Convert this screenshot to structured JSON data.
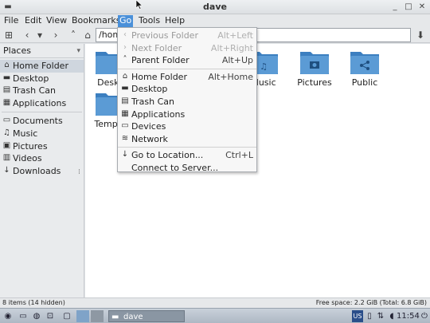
{
  "window": {
    "title": "dave"
  },
  "menubar": {
    "items": [
      "File",
      "Edit",
      "View",
      "Bookmarks",
      "Go",
      "Tools",
      "Help"
    ],
    "active": "Go"
  },
  "toolbar": {
    "path": "/hom"
  },
  "sidebar": {
    "header": "Places",
    "items": [
      {
        "label": "Home Folder",
        "icon": "home-icon"
      },
      {
        "label": "Desktop",
        "icon": "desktop-icon"
      },
      {
        "label": "Trash Can",
        "icon": "trash-icon"
      },
      {
        "label": "Applications",
        "icon": "applications-icon"
      },
      {
        "label": "Documents",
        "icon": "documents-icon"
      },
      {
        "label": "Music",
        "icon": "music-icon"
      },
      {
        "label": "Pictures",
        "icon": "pictures-icon"
      },
      {
        "label": "Videos",
        "icon": "videos-icon"
      },
      {
        "label": "Downloads",
        "icon": "downloads-icon"
      }
    ]
  },
  "folders": [
    {
      "label": "Deskt",
      "icon": "folder-icon"
    },
    {
      "label": "Music",
      "icon": "music-folder-icon"
    },
    {
      "label": "Pictures",
      "icon": "pictures-folder-icon"
    },
    {
      "label": "Public",
      "icon": "public-folder-icon"
    },
    {
      "label": "Templa",
      "icon": "folder-icon"
    }
  ],
  "go_menu": {
    "items": [
      {
        "label": "Previous Folder",
        "accel": "Alt+Left",
        "enabled": false
      },
      {
        "label": "Next Folder",
        "accel": "Alt+Right",
        "enabled": false
      },
      {
        "label": "Parent Folder",
        "accel": "Alt+Up",
        "enabled": true
      },
      {
        "label": "Home Folder",
        "accel": "Alt+Home",
        "enabled": true
      },
      {
        "label": "Desktop",
        "accel": "",
        "enabled": true
      },
      {
        "label": "Trash Can",
        "accel": "",
        "enabled": true
      },
      {
        "label": "Applications",
        "accel": "",
        "enabled": true
      },
      {
        "label": "Devices",
        "accel": "",
        "enabled": true
      },
      {
        "label": "Network",
        "accel": "",
        "enabled": true
      },
      {
        "label": "Go to Location...",
        "accel": "Ctrl+L",
        "enabled": true
      },
      {
        "label": "Connect to Server...",
        "accel": "",
        "enabled": true
      }
    ]
  },
  "statusbar": {
    "left": "8 items (14 hidden)",
    "right": "Free space: 2.2 GiB (Total: 6.8 GiB)"
  },
  "taskbar": {
    "task_label": "dave",
    "keyboard": "US",
    "clock": "11:54"
  },
  "colors": {
    "accent": "#4a90d9",
    "folder": "#5b9bd5",
    "folder_dark": "#3c7fc0"
  }
}
